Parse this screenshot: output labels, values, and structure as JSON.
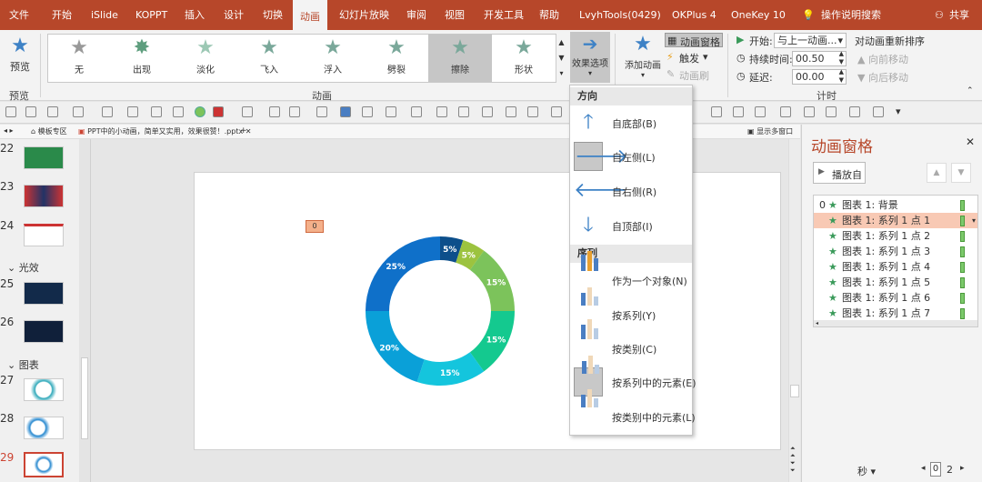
{
  "tabs": [
    "文件",
    "开始",
    "iSlide",
    "KOPPT",
    "插入",
    "设计",
    "切换",
    "动画",
    "幻灯片放映",
    "审阅",
    "视图",
    "开发工具",
    "帮助",
    "LvyhTools(0429)",
    "OKPlus 4",
    "OneKey 10",
    "操作说明搜索",
    "共享"
  ],
  "ribbon": {
    "preview": "预览",
    "preview_group": "预览",
    "animations": [
      {
        "icon": "star-outline",
        "label": "无"
      },
      {
        "icon": "star-burst",
        "label": "出现"
      },
      {
        "icon": "star-faded",
        "label": "淡化"
      },
      {
        "icon": "star-fly",
        "label": "飞入"
      },
      {
        "icon": "star-float",
        "label": "浮入"
      },
      {
        "icon": "star-split",
        "label": "劈裂"
      },
      {
        "icon": "star-wipe",
        "label": "擦除"
      },
      {
        "icon": "star-shape",
        "label": "形状"
      }
    ],
    "anim_group": "动画",
    "effect_options": "效果选项",
    "add_animation": "添加动画",
    "anim_pane": "动画窗格",
    "trigger": "触发",
    "anim_painter": "动画刷",
    "start_label": "开始:",
    "start_value": "与上一动画...",
    "duration_label": "持续时间:",
    "duration_value": "00.50",
    "delay_label": "延迟:",
    "delay_value": "00.00",
    "timing_group": "计时",
    "reorder": "对动画重新排序",
    "move_earlier": "向前移动",
    "move_later": "向后移动"
  },
  "filebar": {
    "tab1": "模板专区",
    "tab2": "PPT中的小动画，简单又实用，效果很赞！.pptx",
    "right": "显示多窗口"
  },
  "thumbnails": [
    {
      "num": "22"
    },
    {
      "num": "23"
    },
    {
      "num": "24"
    },
    {
      "num": "25"
    },
    {
      "num": "26"
    },
    {
      "num": "27"
    },
    {
      "num": "28"
    },
    {
      "num": "29"
    }
  ],
  "sections": {
    "s1": "光效",
    "s2": "图表"
  },
  "slide": {
    "tag": "0"
  },
  "chart_data": {
    "type": "pie",
    "subtype": "donut",
    "labels": [
      "5%",
      "5%",
      "15%",
      "15%",
      "15%",
      "20%",
      "25%"
    ],
    "values": [
      5,
      5,
      15,
      15,
      15,
      20,
      25
    ],
    "colors": [
      "#0d4f8b",
      "#9cc33f",
      "#7cc35b",
      "#14c98f",
      "#14c5dd",
      "#0aa0d8",
      "#0f70c9"
    ]
  },
  "menu": {
    "direction": "方向",
    "dir_items": [
      {
        "icon": "arrow-up",
        "label": "自底部(B)"
      },
      {
        "icon": "arrow-right",
        "label": "自左侧(L)"
      },
      {
        "icon": "arrow-left",
        "label": "自右侧(R)"
      },
      {
        "icon": "arrow-down",
        "label": "自顶部(I)"
      }
    ],
    "sequence": "序列",
    "seq_items": [
      {
        "label": "作为一个对象(N)"
      },
      {
        "label": "按系列(Y)"
      },
      {
        "label": "按类别(C)"
      },
      {
        "label": "按系列中的元素(E)"
      },
      {
        "label": "按类别中的元素(L)"
      }
    ]
  },
  "pane": {
    "title": "动画窗格",
    "play": "播放自",
    "items": [
      {
        "num": "0",
        "label": "图表 1: 背景"
      },
      {
        "label": "图表 1: 系列 1 点 1"
      },
      {
        "label": "图表 1: 系列 1 点 2"
      },
      {
        "label": "图表 1: 系列 1 点 3"
      },
      {
        "label": "图表 1: 系列 1 点 4"
      },
      {
        "label": "图表 1: 系列 1 点 5"
      },
      {
        "label": "图表 1: 系列 1 点 6"
      },
      {
        "label": "图表 1: 系列 1 点 7"
      }
    ],
    "seconds": "秒",
    "page_from": "0",
    "page_to": "2"
  }
}
